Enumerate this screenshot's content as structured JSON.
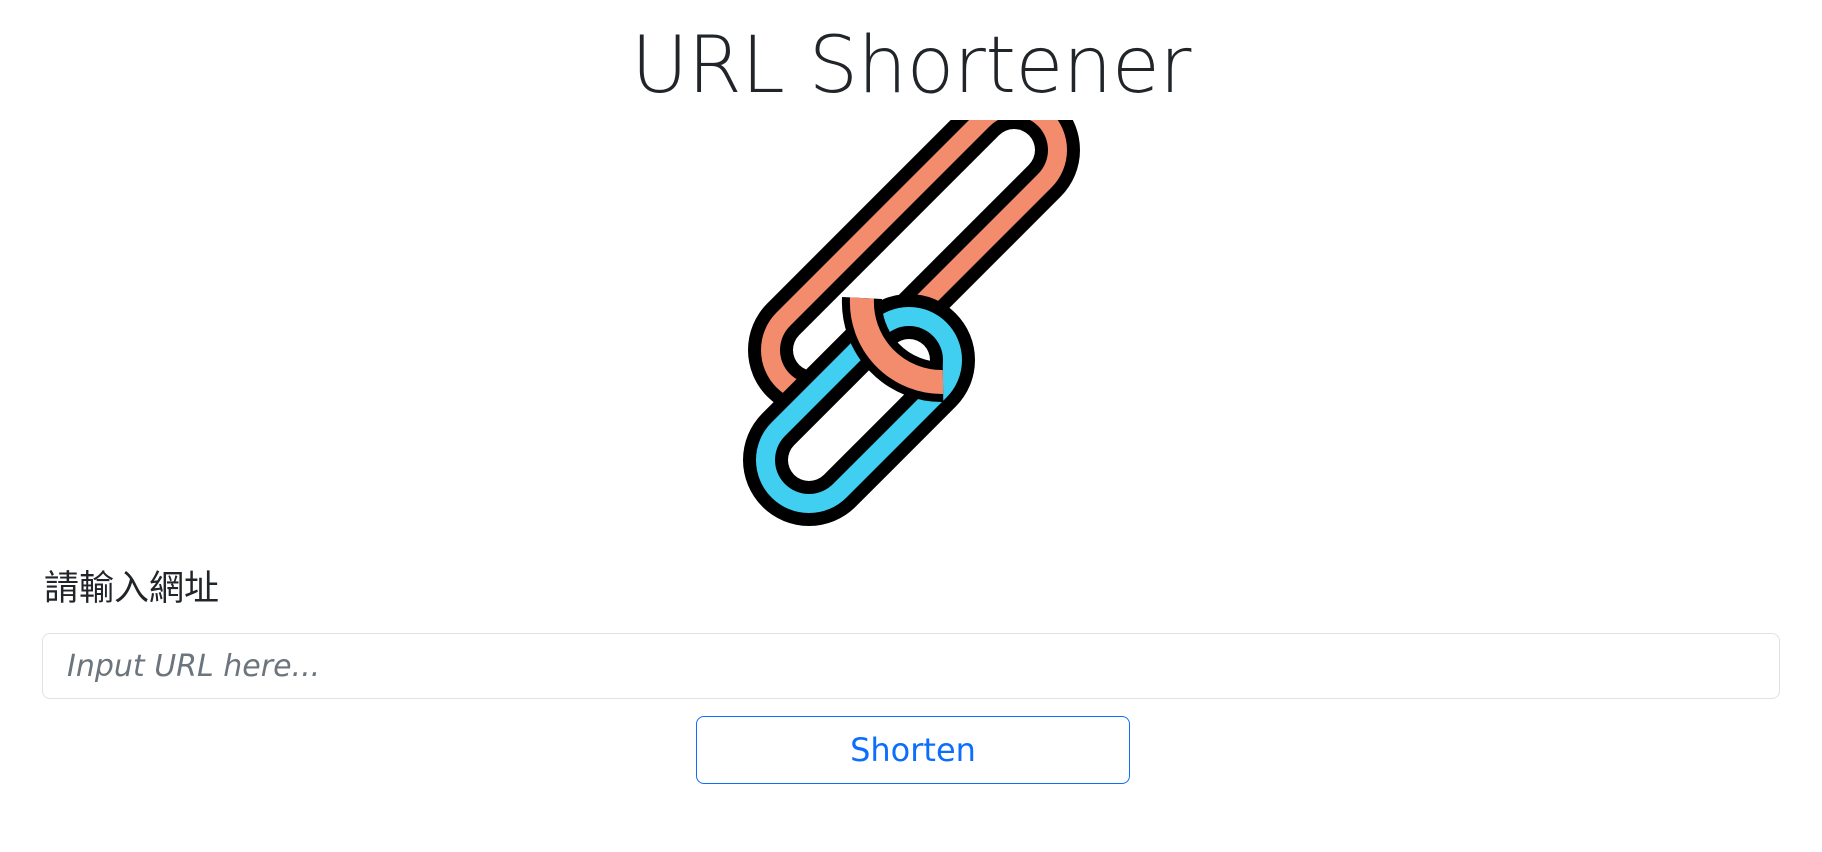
{
  "header": {
    "title": "URL Shortener"
  },
  "logo": {
    "icon": "chain-link-icon",
    "colors": {
      "front_link": "#40cff1",
      "back_link": "#f28c6c",
      "outline": "#000000"
    }
  },
  "form": {
    "label": "請輸入網址",
    "input_value": "",
    "input_placeholder": "Input URL here...",
    "submit_label": "Shorten"
  },
  "theme": {
    "accent": "#0d6efd",
    "text": "#212529",
    "placeholder": "#6c757d",
    "border": "#dee2e6"
  }
}
